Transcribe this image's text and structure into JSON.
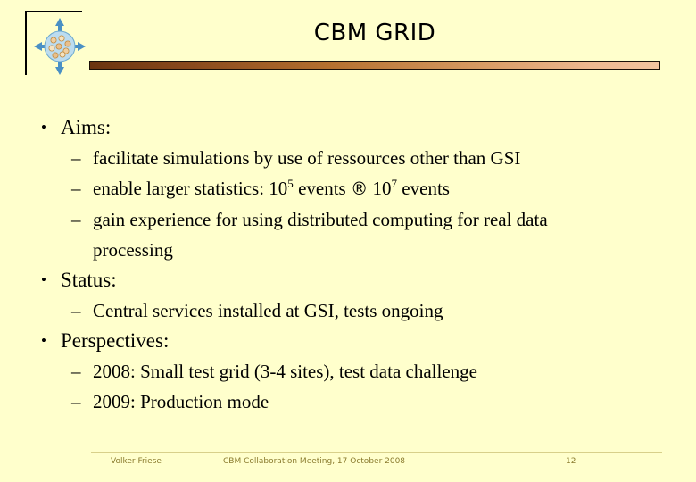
{
  "slide": {
    "title": "CBM GRID",
    "background_color": "#ffffcc",
    "logo": {
      "icon_name": "cbm-collision-logo",
      "description": "blue sphere of particles with four inward arrows"
    }
  },
  "content": {
    "bullets": [
      {
        "level": 1,
        "marker": "•",
        "text": "Aims:"
      },
      {
        "level": 2,
        "marker": "–",
        "text": "facilitate simulations by use of ressources other than GSI"
      },
      {
        "level": 2,
        "marker": "–",
        "text_pre": "enable larger statistics: 10",
        "sup1": "5",
        "text_mid": " events ",
        "arrow": "®",
        "text_post": " 10",
        "sup2": "7",
        "text_end": " events"
      },
      {
        "level": 2,
        "marker": "–",
        "text": "gain experience for using distributed computing for real data",
        "text_cont": "processing"
      },
      {
        "level": 1,
        "marker": "•",
        "text": "Status:"
      },
      {
        "level": 2,
        "marker": "–",
        "text": "Central services installed at GSI, tests ongoing"
      },
      {
        "level": 1,
        "marker": "•",
        "text": "Perspectives:"
      },
      {
        "level": 2,
        "marker": "–",
        "text": "2008: Small test grid (3-4 sites), test data challenge"
      },
      {
        "level": 2,
        "marker": "–",
        "text": "2009: Production mode"
      }
    ]
  },
  "footer": {
    "author": "Volker Friese",
    "meeting": "CBM Collaboration Meeting, 17 October 2008",
    "page_number": "12",
    "text_color": "#8a7b2e"
  },
  "divider": {
    "gradient_start": "#6b3410",
    "gradient_end": "#f3c49f"
  }
}
